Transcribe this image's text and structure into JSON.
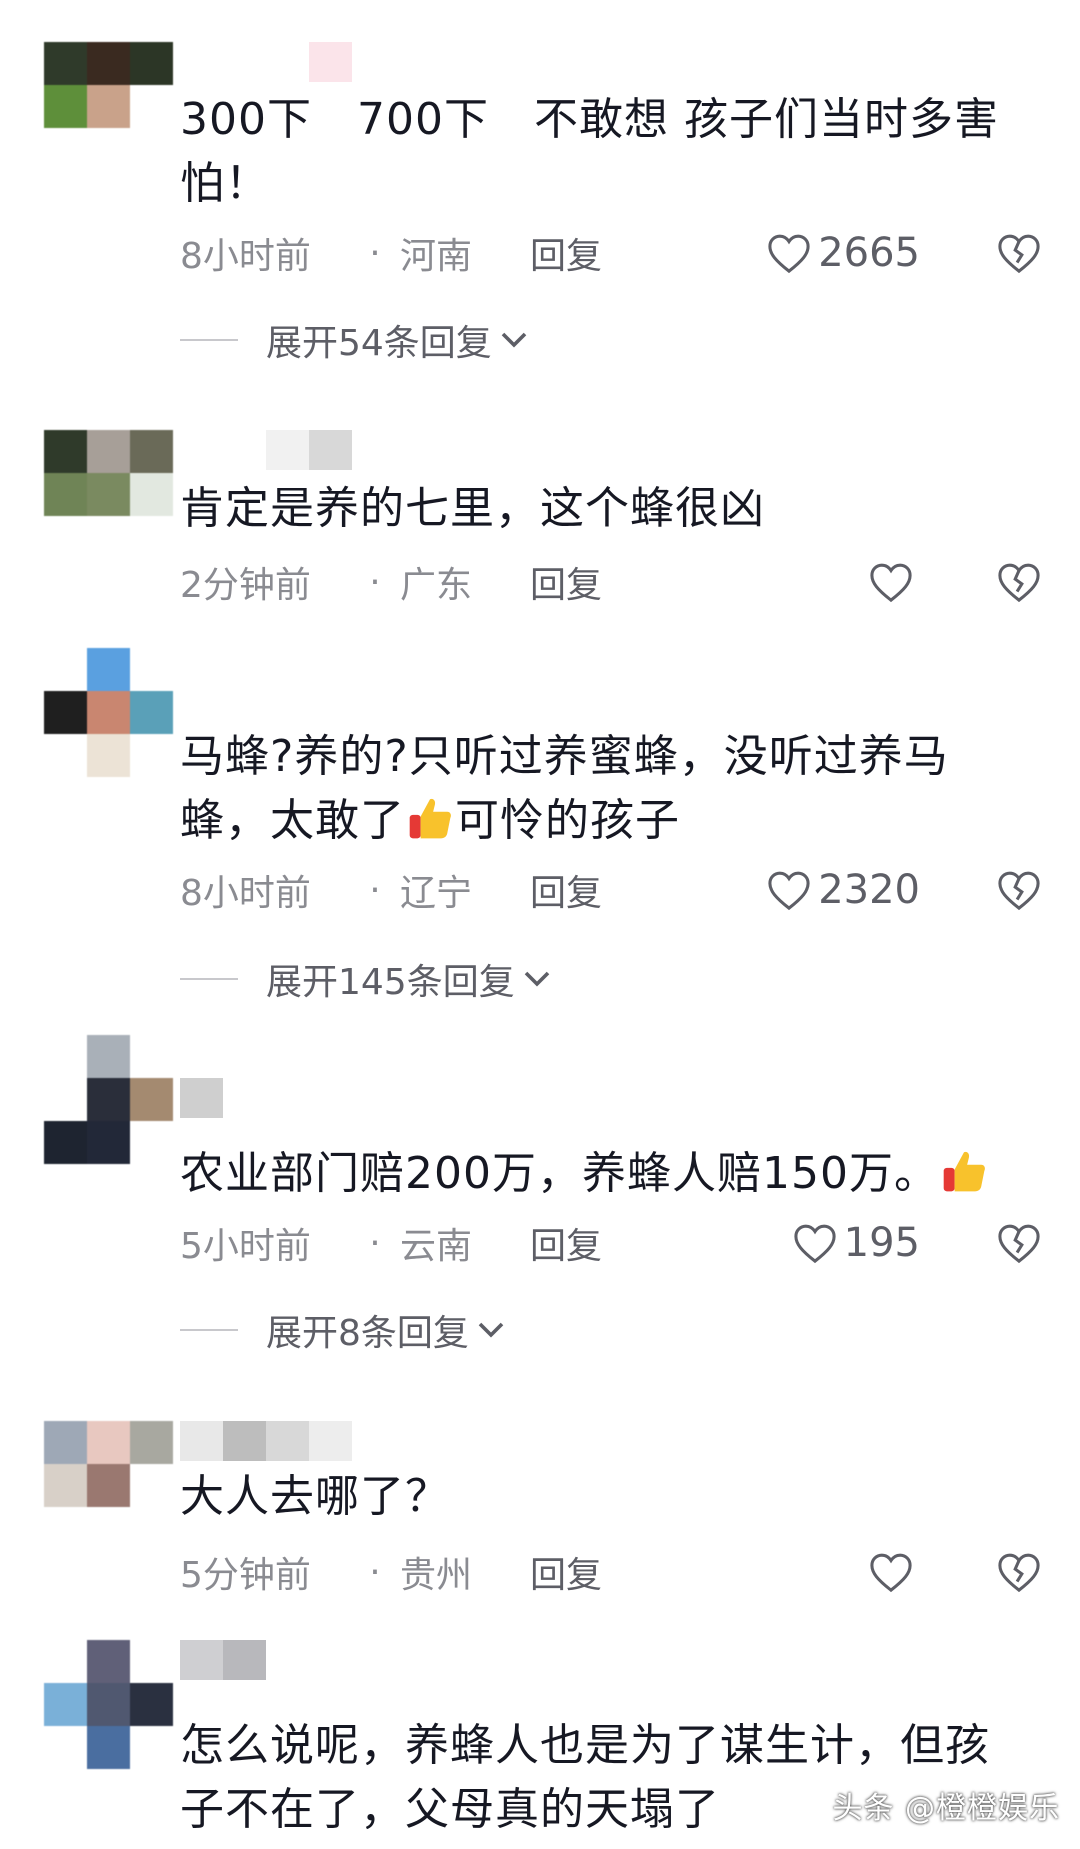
{
  "comments": [
    {
      "text": "300下　700下　不敢想  孩子们当时多害怕！",
      "time": "8小时前",
      "location": "河南",
      "reply": "回复",
      "likes": "2665",
      "expand": "展开54条回复"
    },
    {
      "text": "肯定是养的七里，这个蜂很凶",
      "time": "2分钟前",
      "location": "广东",
      "reply": "回复",
      "likes": "",
      "expand": ""
    },
    {
      "text_before_emoji": "马蜂?养的?只听过养蜜蜂，没听过养马蜂，太敢了",
      "text_after_emoji": "可怜的孩子",
      "emoji": "thumbs-up-emoji",
      "time": "8小时前",
      "location": "辽宁",
      "reply": "回复",
      "likes": "2320",
      "expand": "展开145条回复"
    },
    {
      "text_before_emoji": "农业部门赔200万，养蜂人赔150万。",
      "emoji": "thumbs-up-emoji",
      "time": "5小时前",
      "location": "云南",
      "reply": "回复",
      "likes": "195",
      "expand": "展开8条回复"
    },
    {
      "text": "大人去哪了？",
      "time": "5分钟前",
      "location": "贵州",
      "reply": "回复",
      "likes": "",
      "expand": ""
    },
    {
      "text": "怎么说呢，养蜂人也是为了谋生计，但孩子不在了，父母真的天塌了",
      "time": "",
      "location": "",
      "reply": "",
      "likes": "",
      "expand": ""
    }
  ],
  "separator": "·",
  "watermark": "头条 @橙橙娱乐",
  "icons": {
    "like": "heart-outline-icon",
    "dislike": "broken-heart-icon",
    "expand": "chevron-down-icon"
  },
  "colors": {
    "text": "#161823",
    "meta": "#8a8b91",
    "action": "#5d5e66"
  }
}
